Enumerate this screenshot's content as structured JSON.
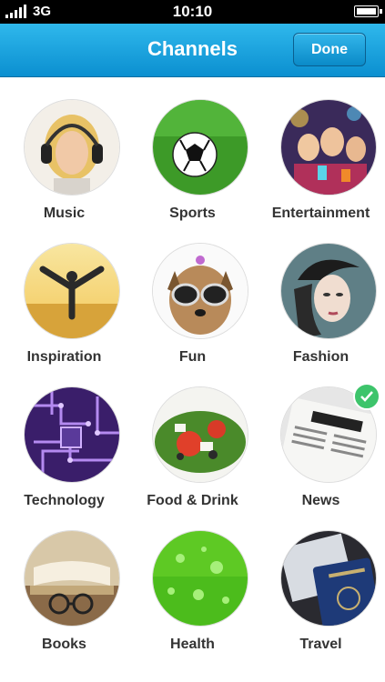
{
  "status_bar": {
    "carrier": "3G",
    "time": "10:10"
  },
  "header": {
    "title": "Channels",
    "done_label": "Done"
  },
  "channels": [
    {
      "label": "Music",
      "icon": "music-icon",
      "selected": false
    },
    {
      "label": "Sports",
      "icon": "soccer-ball-icon",
      "selected": false
    },
    {
      "label": "Entertainment",
      "icon": "party-icon",
      "selected": false
    },
    {
      "label": "Inspiration",
      "icon": "inspiration-icon",
      "selected": false
    },
    {
      "label": "Fun",
      "icon": "dog-sunglasses-icon",
      "selected": false
    },
    {
      "label": "Fashion",
      "icon": "fashion-icon",
      "selected": false
    },
    {
      "label": "Technology",
      "icon": "circuit-board-icon",
      "selected": false
    },
    {
      "label": "Food & Drink",
      "icon": "salad-icon",
      "selected": false
    },
    {
      "label": "News",
      "icon": "newspaper-icon",
      "selected": true
    },
    {
      "label": "Books",
      "icon": "books-icon",
      "selected": false
    },
    {
      "label": "Health",
      "icon": "water-drops-icon",
      "selected": false
    },
    {
      "label": "Travel",
      "icon": "passport-icon",
      "selected": false
    }
  ],
  "colors": {
    "nav_top": "#2fb8ec",
    "nav_bottom": "#0b8fd0",
    "check": "#3dc46b"
  }
}
